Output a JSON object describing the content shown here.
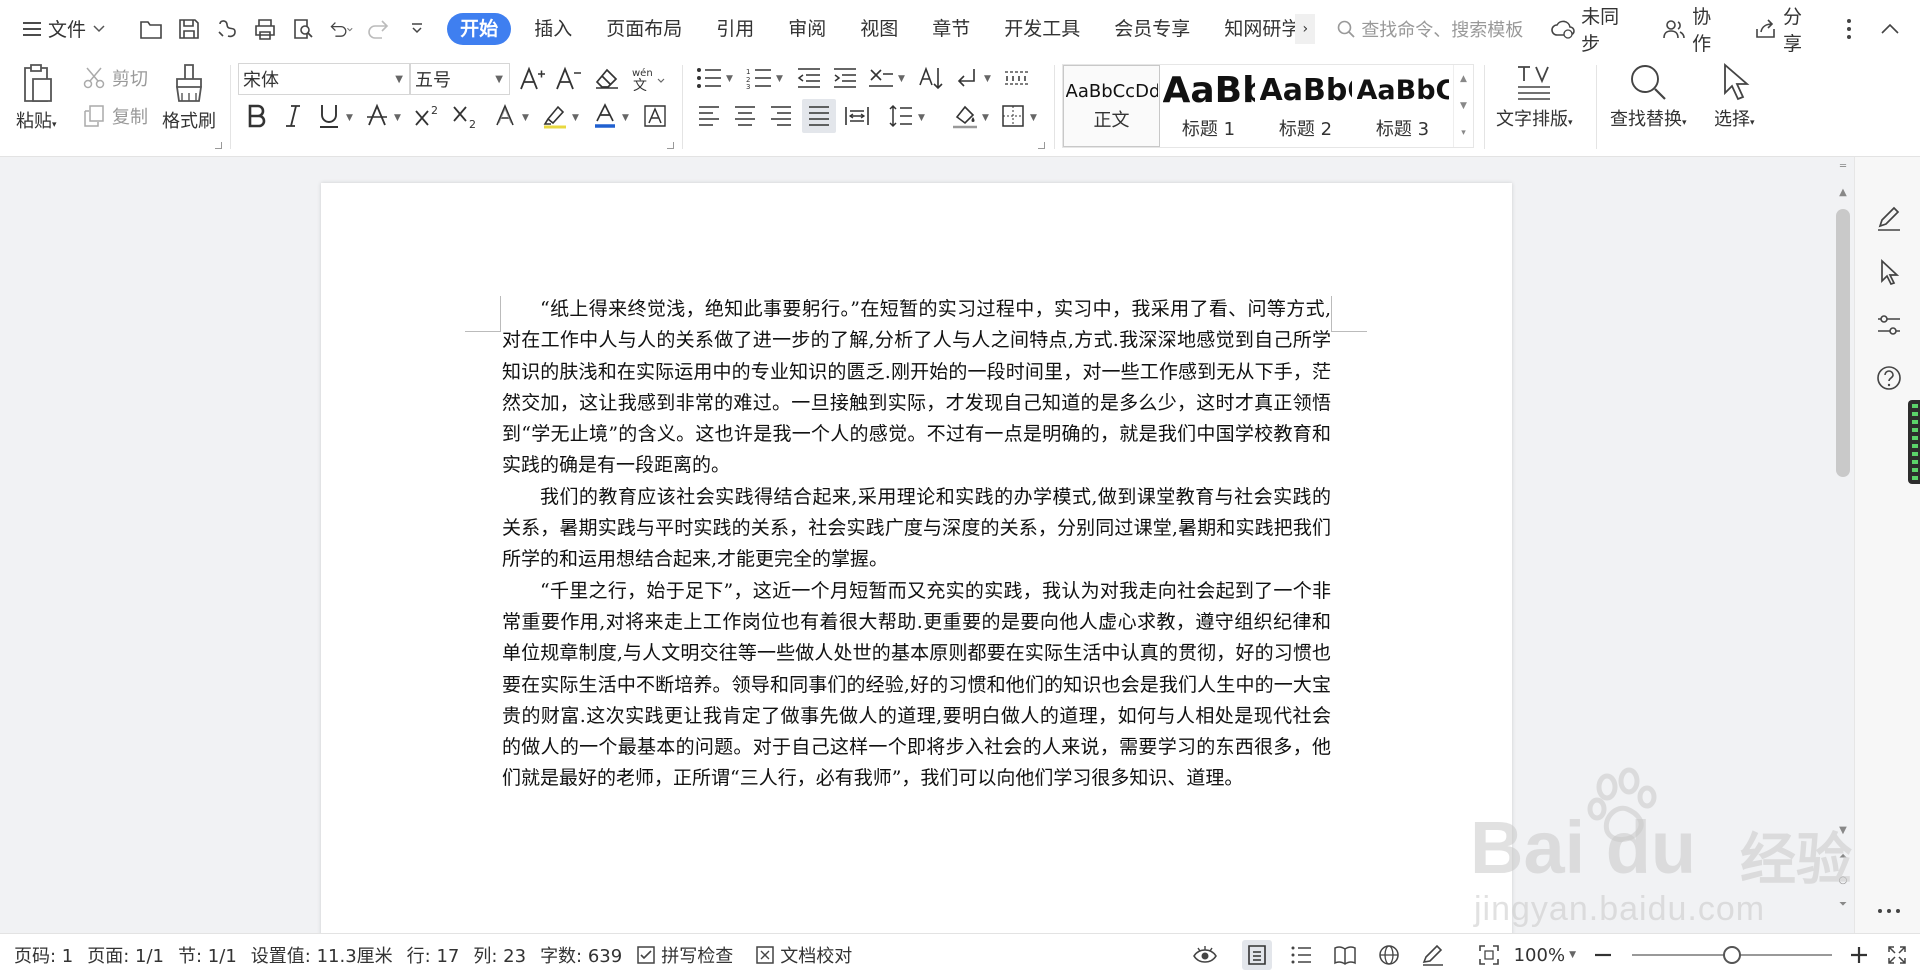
{
  "menubar": {
    "file_label": "文件",
    "tabs": [
      "开始",
      "插入",
      "页面布局",
      "引用",
      "审阅",
      "视图",
      "章节",
      "开发工具",
      "会员专享",
      "知网研学"
    ],
    "active_tab": "开始",
    "tab_more": "›",
    "search_placeholder": "查找命令、搜索模板",
    "sync_label": "未同步",
    "collab_label": "协作",
    "share_label": "分享"
  },
  "ribbon": {
    "paste_label": "粘贴",
    "cut_label": "剪切",
    "copy_label": "复制",
    "format_painter_label": "格式刷",
    "font_name": "宋体",
    "font_size": "五号",
    "styles": [
      {
        "preview": "AaBbCcDd",
        "name": "正文"
      },
      {
        "preview": "AaBb",
        "name": "标题 1"
      },
      {
        "preview": "AaBbC",
        "name": "标题 2"
      },
      {
        "preview": "AaBbC",
        "name": "标题 3"
      }
    ],
    "text_layout_label": "文字排版",
    "find_replace_label": "查找替换",
    "select_label": "选择"
  },
  "document": {
    "paragraphs": [
      "“纸上得来终觉浅，绝知此事要躬行。”在短暂的实习过程中，实习中，我采用了看、问等方式,对在工作中人与人的关系做了进一步的了解,分析了人与人之间特点,方式.我深深地感觉到自己所学知识的肤浅和在实际运用中的专业知识的匮乏.刚开始的一段时间里，对一些工作感到无从下手，茫然交加，这让我感到非常的难过。一旦接触到实际，才发现自己知道的是多么少，这时才真正领悟到“学无止境”的含义。这也许是我一个人的感觉。不过有一点是明确的，就是我们中国学校教育和实践的确是有一段距离的。",
      "我们的教育应该社会实践得结合起来,采用理论和实践的办学模式,做到课堂教育与社会实践的关系，暑期实践与平时实践的关系，社会实践广度与深度的关系，分别同过课堂,暑期和实践把我们所学的和运用想结合起来,才能更完全的掌握。",
      "“千里之行，始于足下”，这近一个月短暂而又充实的实践，我认为对我走向社会起到了一个非常重要作用,对将来走上工作岗位也有着很大帮助.更重要的是要向他人虚心求教，遵守组织纪律和单位规章制度,与人文明交往等一些做人处世的基本原则都要在实际生活中认真的贯彻，好的习惯也要在实际生活中不断培养。领导和同事们的经验,好的习惯和他们的知识也会是我们人生中的一大宝贵的财富.这次实践更让我肯定了做事先做人的道理,要明白做人的道理，如何与人相处是现代社会的做人的一个最基本的问题。对于自己这样一个即将步入社会的人来说，需要学习的东西很多，他们就是最好的老师，正所谓“三人行，必有我师”，我们可以向他们学习很多知识、道理。"
    ]
  },
  "statusbar": {
    "page_num": "页码: 1",
    "page_count": "页面: 1/1",
    "section": "节: 1/1",
    "setting": "设置值: 11.3厘米",
    "row": "行: 17",
    "col": "列: 23",
    "word_count": "字数: 639",
    "spellcheck": "拼写检查",
    "doc_proof": "文档校对",
    "zoom": "100%",
    "zoom_level_fraction": 0.5
  },
  "watermark": {
    "brand": "Bai  du",
    "brand_cn": "经验",
    "url": "jingyan.baidu.com"
  },
  "colors": {
    "accent": "#3f7ff0",
    "font_color_red": "#e03030",
    "font_color_blue": "#2060d0"
  }
}
